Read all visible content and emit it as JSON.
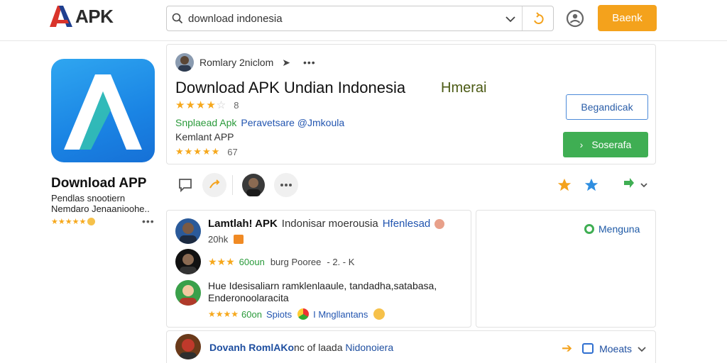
{
  "header": {
    "logo_text": "APK",
    "search_value": "download indonesia",
    "button_label": "Baenk"
  },
  "app": {
    "left_title": "Download APP",
    "left_sub1": "Pendlas snootiern",
    "left_sub2": "Nemdaro Jenaanioohe..",
    "author": "Romlary 2niclom",
    "title": "Download APK Undian Indonesia",
    "tag": "Hmerai",
    "rating_count": "8",
    "developer_green": "Snplaead Apk",
    "developer_blue": "Peravetsare @Jmkoula",
    "category": "Kemlant APP",
    "rating_count2": "67",
    "button_outline": "Begandicak",
    "button_primary": "Soserafa"
  },
  "reviews": [
    {
      "title": "Lamtlah! APK",
      "title_tail_plain": "Indonisar moerousia",
      "title_tail_blue": "Hfenlesad",
      "sub": "20hk"
    },
    {
      "meta_green": "60oun",
      "meta_plain": "burg Pooree",
      "meta_tail": "- 2. - K"
    },
    {
      "text_line1": "Hue Idesisaliarn ramklenlaaule, tandadha,satabasa,",
      "text_line2": "Enderonoolaracita",
      "meta_green": "60on",
      "meta_blue1": "Spiots",
      "meta_blue2": "I Mngllantans"
    }
  ],
  "side": {
    "label": "Menguna"
  },
  "bottom": {
    "title": "Dovanh RomlAKo",
    "title_plain": "nc of laada",
    "title_blue": "Nidonoiera",
    "action_label": "Moeats"
  },
  "colors": {
    "accent": "#f4a21c",
    "green": "#3fae53",
    "blue": "#2255b0",
    "star": "#f6a81c"
  }
}
